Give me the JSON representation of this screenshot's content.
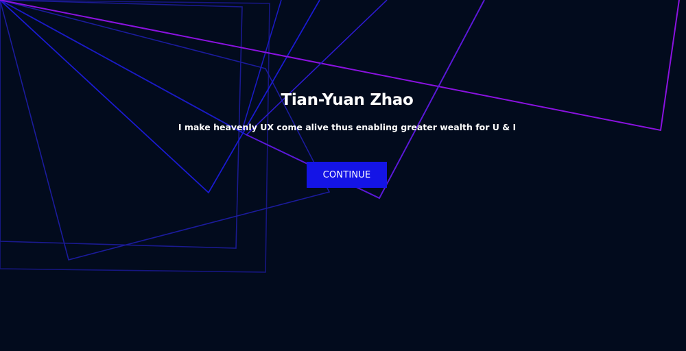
{
  "hero": {
    "title": "Tian-Yuan Zhao",
    "subtitle": "I make heavenly UX come alive thus enabling greater wealth for U & I",
    "cta_label": "CONTINUE"
  },
  "colors": {
    "background": "#020b1d",
    "accent": "#1414e6",
    "line_blue": "#1a1ad0",
    "line_violet": "#8a12e0",
    "text": "#ffffff"
  }
}
